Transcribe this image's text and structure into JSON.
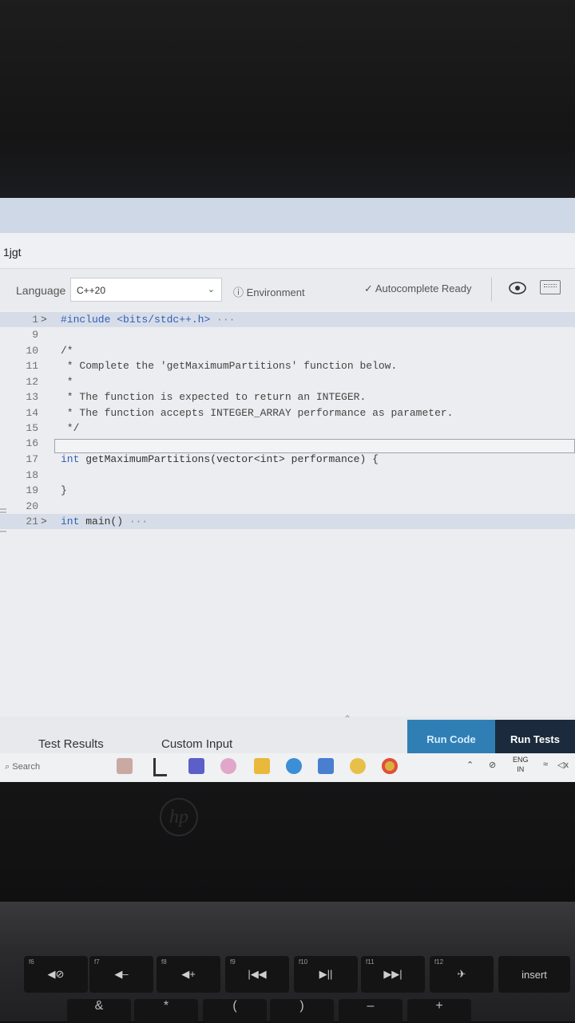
{
  "window": {
    "title": "1jgt"
  },
  "toolbar": {
    "language_label": "Language",
    "language_value": "C++20",
    "environment_label": "Environment",
    "autocomplete_label": "Autocomplete Ready"
  },
  "editor": {
    "lines": [
      {
        "num": "1",
        "text": "#include <bits/stdc++.h>",
        "folded": true,
        "suffix": "···"
      },
      {
        "num": "9",
        "text": ""
      },
      {
        "num": "10",
        "text": "/*"
      },
      {
        "num": "11",
        "text": " * Complete the 'getMaximumPartitions' function below."
      },
      {
        "num": "12",
        "text": " *"
      },
      {
        "num": "13",
        "text": " * The function is expected to return an INTEGER."
      },
      {
        "num": "14",
        "text": " * The function accepts INTEGER_ARRAY performance as parameter."
      },
      {
        "num": "15",
        "text": " */"
      },
      {
        "num": "16",
        "text": ""
      },
      {
        "num": "17",
        "text": "int getMaximumPartitions(vector<int> performance) {"
      },
      {
        "num": "18",
        "text": ""
      },
      {
        "num": "19",
        "text": "}"
      },
      {
        "num": "20",
        "text": ""
      },
      {
        "num": "21",
        "text": "int main()",
        "folded": true,
        "suffix": "···"
      }
    ]
  },
  "bottom_tabs": {
    "test_results": "Test Results",
    "custom_input": "Custom Input"
  },
  "actions": {
    "run_code": "Run Code",
    "run_tests": "Run Tests"
  },
  "taskbar": {
    "search": "Search",
    "lang_top": "ENG",
    "lang_bottom": "IN"
  },
  "keyboard": {
    "fn_labels": [
      "f6",
      "f7",
      "f8",
      "f9",
      "f10",
      "f11",
      "f12"
    ],
    "fn_glyphs": [
      "◀⊘",
      "◀–",
      "◀+",
      "|◀◀",
      "▶||",
      "▶▶|",
      "✈"
    ],
    "insert": "insert",
    "num_glyphs": [
      "&",
      "*",
      "(",
      ")",
      "–",
      "+"
    ]
  }
}
